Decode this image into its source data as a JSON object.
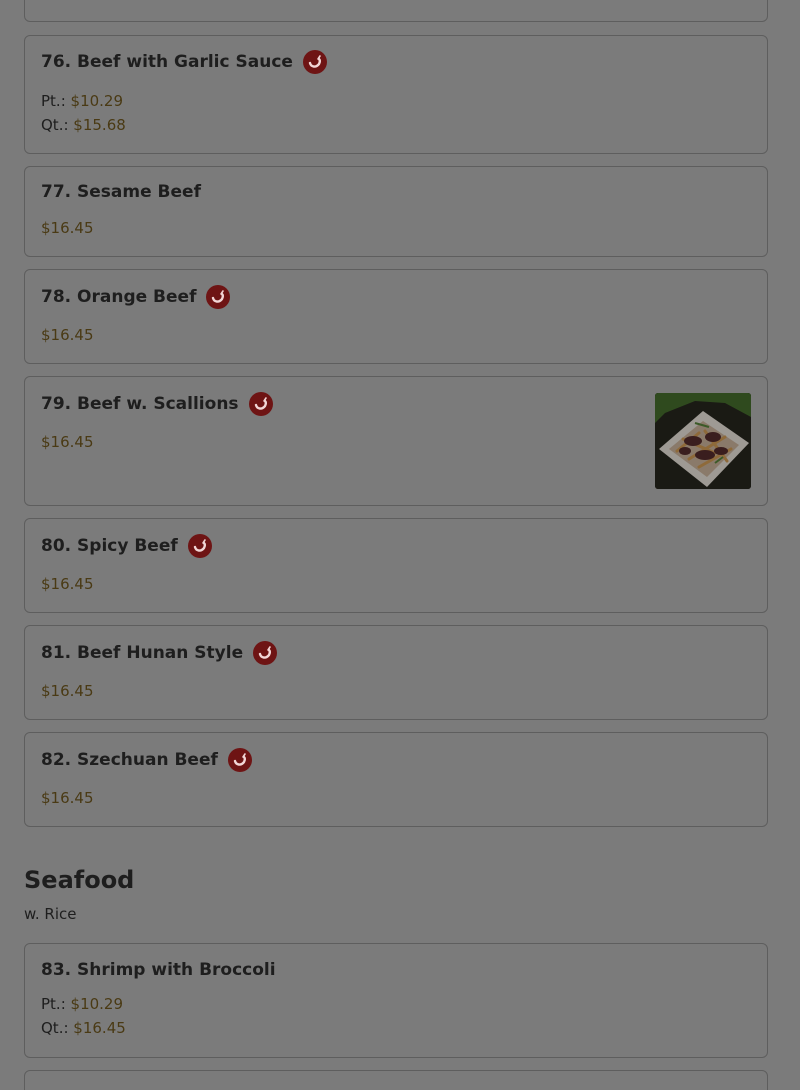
{
  "items": [
    {
      "title": "76. Beef with Garlic Sauce",
      "spicy": true,
      "prices": [
        {
          "label": "Pt.:",
          "value": "$10.29"
        },
        {
          "label": "Qt.:",
          "value": "$15.68"
        }
      ]
    },
    {
      "title": "77. Sesame Beef",
      "spicy": false,
      "price": "$16.45"
    },
    {
      "title": "78. Orange Beef",
      "spicy": true,
      "price": "$16.45"
    },
    {
      "title": "79. Beef w. Scallions",
      "spicy": true,
      "price": "$16.45",
      "has_image": true
    },
    {
      "title": "80. Spicy Beef",
      "spicy": true,
      "price": "$16.45"
    },
    {
      "title": "81. Beef Hunan Style",
      "spicy": true,
      "price": "$16.45"
    },
    {
      "title": "82. Szechuan Beef",
      "spicy": true,
      "price": "$16.45"
    },
    {
      "title": "83. Shrimp with Broccoli",
      "spicy": false,
      "prices": [
        {
          "label": "Pt.:",
          "value": "$10.29"
        },
        {
          "label": "Qt.:",
          "value": "$16.45"
        }
      ]
    }
  ],
  "section": {
    "title": "Seafood",
    "subtitle": "w. Rice"
  },
  "icons": {
    "spicy": "chili-pepper-icon"
  },
  "colors": {
    "overlay_bg": "#7b7b7b",
    "price": "#4a3a14",
    "spicy_badge": "#6e1414"
  }
}
